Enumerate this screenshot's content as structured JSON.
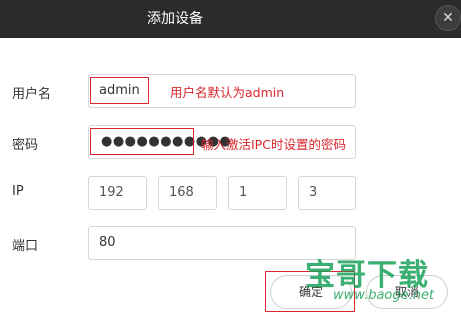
{
  "dialog": {
    "title": "添加设备",
    "close_glyph": "✕"
  },
  "form": {
    "username": {
      "label": "用户名",
      "value": "admin",
      "note": "用户名默认为admin"
    },
    "password": {
      "label": "密码",
      "masked_value": "●●●●●●●●●●●",
      "note": "输入激活IPC时设置的密码"
    },
    "ip": {
      "label": "IP",
      "octets": [
        "192",
        "168",
        "1",
        "3"
      ]
    },
    "port": {
      "label": "端口",
      "value": "80"
    }
  },
  "buttons": {
    "confirm": "确定",
    "cancel": "取消"
  },
  "watermark": {
    "text": "宝哥下载",
    "url": "www.baoge.net"
  },
  "colors": {
    "titlebar": "#2b2b2b",
    "annotation_red": "#d9262c",
    "watermark_green": "#1aa35a"
  }
}
